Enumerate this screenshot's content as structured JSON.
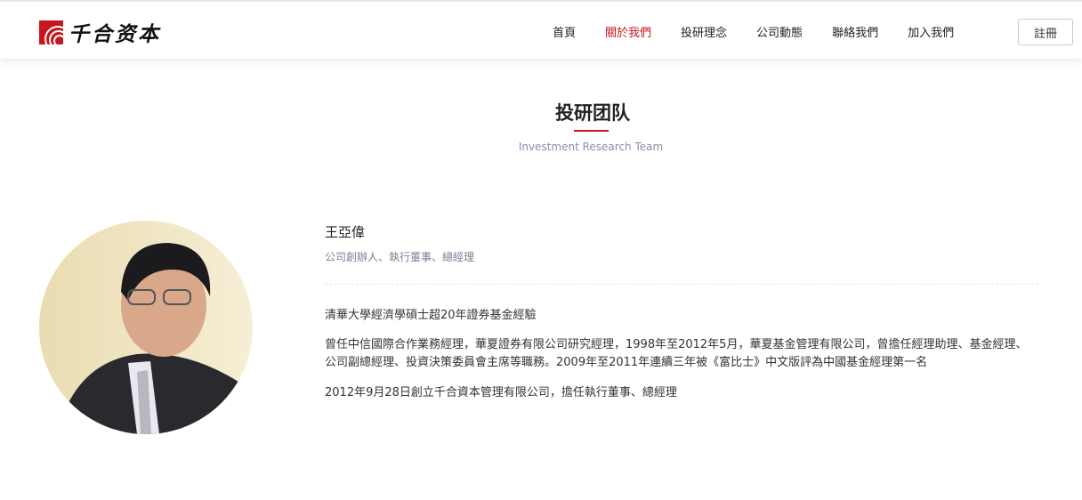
{
  "header": {
    "logo_text": "千合资本",
    "nav": [
      "首頁",
      "關於我們",
      "投研理念",
      "公司動態",
      "聯絡我們",
      "加入我們"
    ],
    "active_index": 1,
    "register_label": "註冊"
  },
  "section": {
    "title": "投研团队",
    "subtitle": "Investment Research Team"
  },
  "profile": {
    "name": "王亞偉",
    "role": "公司創辦人、執行董事、總經理",
    "bio": [
      "清華大學經濟學碩士超20年證券基金經驗",
      "曾任中信國際合作業務經理，華夏證券有限公司研究經理，1998年至2012年5月，華夏基金管理有限公司，曾擔任經理助理、基金經理、公司副總經理、投資決策委員會主席等職務。2009年至2011年連續三年被《富比士》中文版評為中國基金經理第一名",
      "2012年9月28日創立千合資本管理有限公司，擔任執行董事、總經理"
    ]
  },
  "colors": {
    "accent": "#c8161d",
    "muted": "#8a8ea8"
  }
}
